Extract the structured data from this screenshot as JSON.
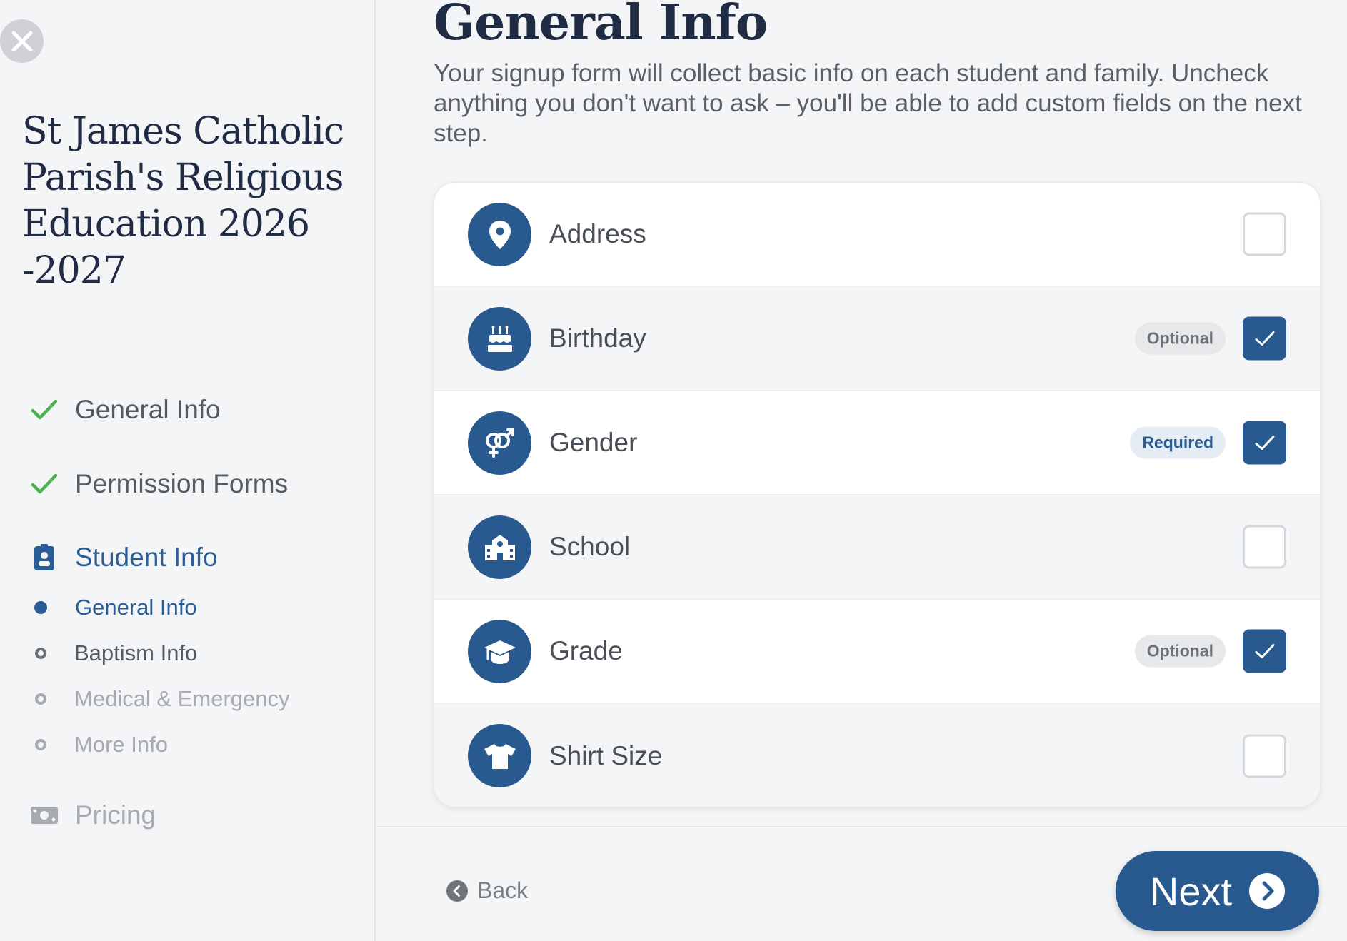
{
  "sidebar": {
    "org_title": "St James Catholic Parish's Religious Education 2026 -2027",
    "steps": [
      {
        "label": "General Info",
        "state": "done"
      },
      {
        "label": "Permission Forms",
        "state": "done"
      },
      {
        "label": "Student Info",
        "state": "active"
      },
      {
        "label": "Pricing",
        "state": "upcoming"
      }
    ],
    "sub_steps": [
      {
        "label": "General Info",
        "state": "active"
      },
      {
        "label": "Baptism Info",
        "state": "upcoming"
      },
      {
        "label": "Medical & Emergency",
        "state": "upcoming"
      },
      {
        "label": "More Info",
        "state": "upcoming"
      }
    ]
  },
  "main": {
    "title": "General Info",
    "description": "Your signup form will collect basic info on each student and family. Uncheck anything you don't want to ask – you'll be able to add custom fields on the next step.",
    "fields": [
      {
        "label": "Address",
        "icon": "map-pin-icon",
        "badge": null,
        "checked": false
      },
      {
        "label": "Birthday",
        "icon": "birthday-cake-icon",
        "badge": "Optional",
        "checked": true
      },
      {
        "label": "Gender",
        "icon": "gender-icon",
        "badge": "Required",
        "checked": true
      },
      {
        "label": "School",
        "icon": "school-icon",
        "badge": null,
        "checked": false
      },
      {
        "label": "Grade",
        "icon": "graduation-cap-icon",
        "badge": "Optional",
        "checked": true
      },
      {
        "label": "Shirt Size",
        "icon": "shirt-icon",
        "badge": null,
        "checked": false
      }
    ]
  },
  "footer": {
    "back_label": "Back",
    "next_label": "Next"
  },
  "colors": {
    "primary": "#28598f",
    "title": "#1f2c44",
    "success": "#4caf50"
  }
}
